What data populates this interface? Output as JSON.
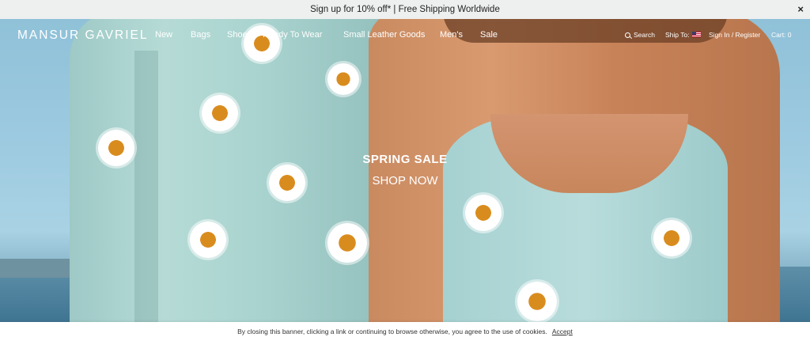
{
  "promo": {
    "text": "Sign up for 10% off* | Free Shipping Worldwide",
    "close_glyph": "×"
  },
  "header": {
    "logo": "MANSUR GAVRIEL",
    "nav": [
      "New",
      "Bags",
      "Shoes",
      "Ready To Wear",
      "Small Leather Goods",
      "Men's",
      "Sale"
    ],
    "search_label": "Search",
    "ship_to_label": "Ship To:",
    "ship_to_flag": "us-flag-icon",
    "sign_in_label": "Sign In / Register",
    "cart_label": "Cart: 0"
  },
  "hero": {
    "title": "SPRING SALE",
    "cta": "SHOP NOW"
  },
  "cookie": {
    "text": "By closing this banner, clicking a link or continuing to browse otherwise, you agree to the use of cookies.",
    "accept_label": "Accept"
  },
  "colors": {
    "promo_bg": "#eef0ef",
    "hero_text": "#ffffff",
    "sweater": "#b6dbd6",
    "daisy_center": "#d98c1e"
  }
}
